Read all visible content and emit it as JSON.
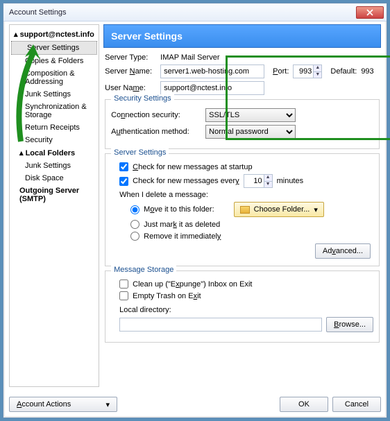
{
  "window": {
    "title": "Account Settings"
  },
  "sidebar": {
    "account": "support@nctest.info",
    "items": [
      "Server Settings",
      "Copies & Folders",
      "Composition & Addressing",
      "Junk Settings",
      "Synchronization & Storage",
      "Return Receipts",
      "Security"
    ],
    "local_label": "Local Folders",
    "local_items": [
      "Junk Settings",
      "Disk Space"
    ],
    "outgoing": "Outgoing Server (SMTP)",
    "account_actions": "Account Actions"
  },
  "main": {
    "heading": "Server Settings",
    "server_type_label": "Server Type:",
    "server_type_value": "IMAP Mail Server",
    "server_name_label": "Server Name:",
    "server_name_value": "server1.web-hosting.com",
    "port_label": "Port:",
    "port_value": "993",
    "default_port_label": "Default:",
    "default_port_value": "993",
    "user_name_label": "User Name:",
    "user_name_value": "support@nctest.info",
    "security": {
      "legend": "Security Settings",
      "conn_label": "Connection security:",
      "conn_value": "SSL/TLS",
      "auth_label": "Authentication method:",
      "auth_value": "Normal password"
    },
    "server_settings": {
      "legend": "Server Settings",
      "check_startup": "Check for new messages at startup",
      "check_every_pre": "Check for new messages every",
      "check_every_value": "10",
      "check_every_post": "minutes",
      "delete_label": "When I delete a message:",
      "opt_move": "Move it to this folder:",
      "choose_folder": "Choose Folder...",
      "opt_mark": "Just mark it as deleted",
      "opt_remove": "Remove it immediately",
      "advanced": "Advanced..."
    },
    "storage": {
      "legend": "Message Storage",
      "cleanup": "Clean up (\"Expunge\") Inbox on Exit",
      "empty_trash": "Empty Trash on Exit",
      "localdir_label": "Local directory:",
      "localdir_value": "",
      "browse": "Browse..."
    }
  },
  "buttons": {
    "ok": "OK",
    "cancel": "Cancel"
  }
}
